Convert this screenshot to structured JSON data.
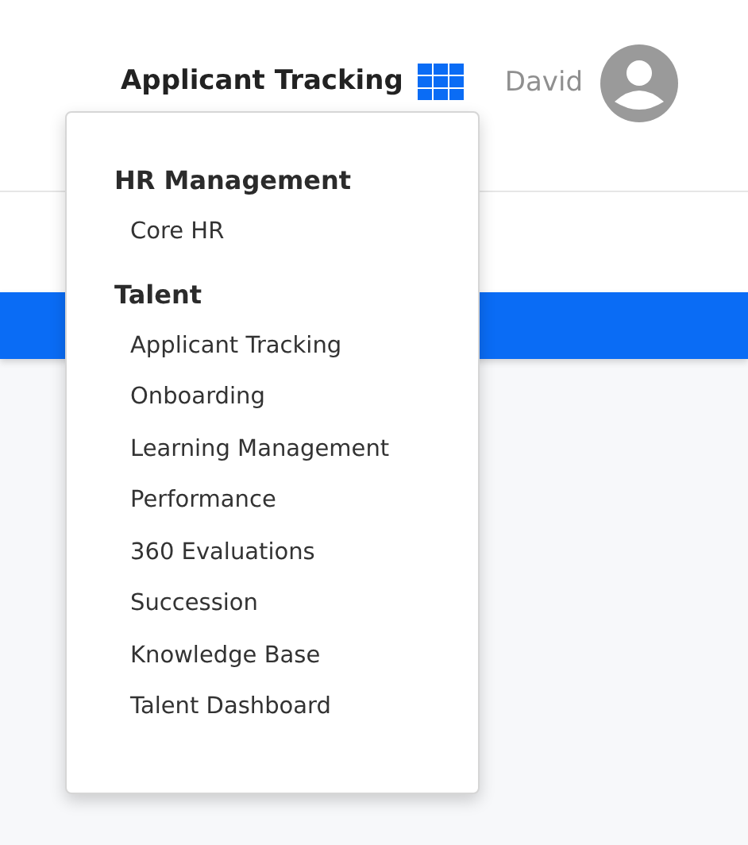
{
  "header": {
    "current_app": "Applicant Tracking",
    "user_name": "David"
  },
  "app_menu": {
    "groups": [
      {
        "title": "HR Management",
        "items": [
          "Core HR"
        ]
      },
      {
        "title": "Talent",
        "items": [
          "Applicant Tracking",
          "Onboarding",
          "Learning Management",
          "Performance",
          "360 Evaluations",
          "Succession",
          "Knowledge Base",
          "Talent Dashboard"
        ]
      }
    ]
  }
}
